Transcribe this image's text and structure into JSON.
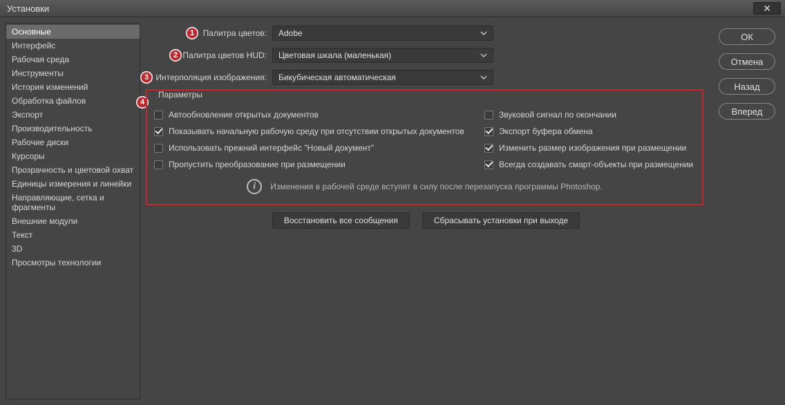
{
  "window": {
    "title": "Установки"
  },
  "sidebar": {
    "items": [
      "Основные",
      "Интерфейс",
      "Рабочая среда",
      "Инструменты",
      "История изменений",
      "Обработка файлов",
      "Экспорт",
      "Производительность",
      "Рабочие диски",
      "Курсоры",
      "Прозрачность и цветовой охват",
      "Единицы измерения и линейки",
      "Направляющие, сетка и фрагменты",
      "Внешние модули",
      "Текст",
      "3D",
      "Просмотры технологии"
    ],
    "selected_index": 0
  },
  "dropdowns": {
    "color_picker": {
      "label": "Палитра цветов:",
      "value": "Adobe"
    },
    "hud_color_picker": {
      "label": "Палитра цветов HUD:",
      "value": "Цветовая шкала (маленькая)"
    },
    "image_interpolation": {
      "label": "Интерполяция изображения:",
      "value": "Бикубическая автоматическая"
    }
  },
  "fieldset": {
    "legend": "Параметры",
    "left": [
      {
        "label": "Автообновление открытых документов",
        "checked": false
      },
      {
        "label": "Показывать начальную рабочую среду при отсутствии открытых документов",
        "checked": true
      },
      {
        "label": "Использовать прежний интерфейс \"Новый документ\"",
        "checked": false
      },
      {
        "label": "Пропустить преобразование при размещении",
        "checked": false
      }
    ],
    "right": [
      {
        "label": "Звуковой сигнал по окончании",
        "checked": false
      },
      {
        "label": "Экспорт буфера обмена",
        "checked": true
      },
      {
        "label": "Изменить размер изображения при размещении",
        "checked": true
      },
      {
        "label": "Всегда создавать смарт-объекты при размещении",
        "checked": true
      }
    ],
    "info": "Изменения в рабочей среде вступят в силу после перезапуска программы Photoshop."
  },
  "bottom_buttons": {
    "reset_dialogs": "Восстановить все сообщения",
    "reset_on_quit": "Сбрасывать установки при выходе"
  },
  "right_buttons": {
    "ok": "ОК",
    "cancel": "Отмена",
    "prev": "Назад",
    "next": "Вперед"
  },
  "markers": [
    "1",
    "2",
    "3",
    "4"
  ]
}
